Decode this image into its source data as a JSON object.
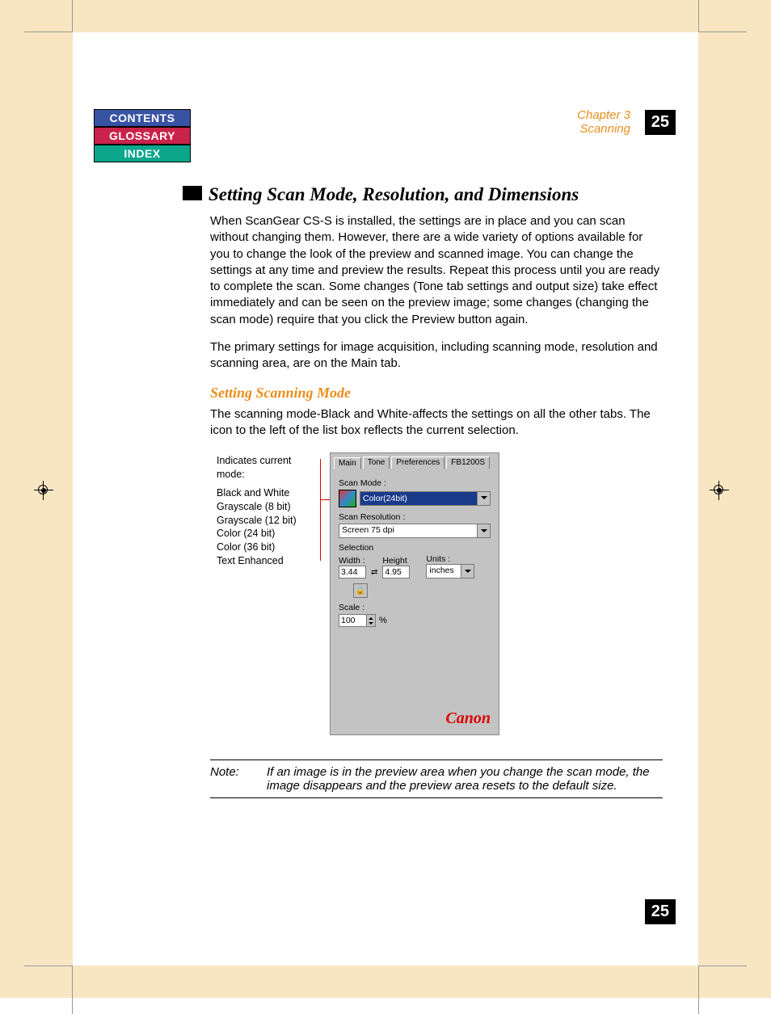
{
  "nav": {
    "contents": "CONTENTS",
    "glossary": "GLOSSARY",
    "index": "INDEX"
  },
  "chapter": {
    "line1": "Chapter 3",
    "line2": "Scanning"
  },
  "page_number": "25",
  "h1": "Setting Scan Mode, Resolution, and Dimensions",
  "p1": "When ScanGear CS-S is installed, the settings are in place and you can scan without changing them. However, there are a wide variety of options available for you to change the look of the preview and scanned image. You can change the settings at any time and preview the results. Repeat this process until you are ready to complete the scan. Some changes (Tone tab settings and output size) take effect immediately and can be seen on the preview image; some changes (changing the scan mode) require that you click the Preview button again.",
  "p2": "The primary settings for image acquisition, including scanning mode, resolution and scanning area, are on the Main tab.",
  "h2": "Setting Scanning Mode",
  "p3": "The scanning mode-Black and White-affects the settings on all the other tabs. The icon to the left of the list box reflects the current selection.",
  "callout": {
    "lead": "Indicates current mode:",
    "items": [
      "Black and White",
      "Grayscale (8 bit)",
      "Grayscale (12 bit)",
      "Color (24 bit)",
      "Color (36 bit)",
      "Text Enhanced"
    ]
  },
  "mock": {
    "tabs": [
      "Main",
      "Tone",
      "Preferences",
      "FB1200S"
    ],
    "scan_mode_label": "Scan Mode :",
    "scan_mode_value": "Color(24bit)",
    "scan_res_label": "Scan Resolution :",
    "scan_res_value": "Screen 75 dpi",
    "selection_label": "Selection",
    "width_label": "Width :",
    "height_label": "Height",
    "units_label": "Units :",
    "width_value": "3.44",
    "height_value": "4.95",
    "units_value": "inches",
    "scale_label": "Scale :",
    "scale_value": "100",
    "scale_unit": "%",
    "brand": "Canon"
  },
  "note": {
    "label": "Note:",
    "text": "If an image is in the preview area when you change the scan mode, the image disappears and the preview area resets to the default size."
  }
}
